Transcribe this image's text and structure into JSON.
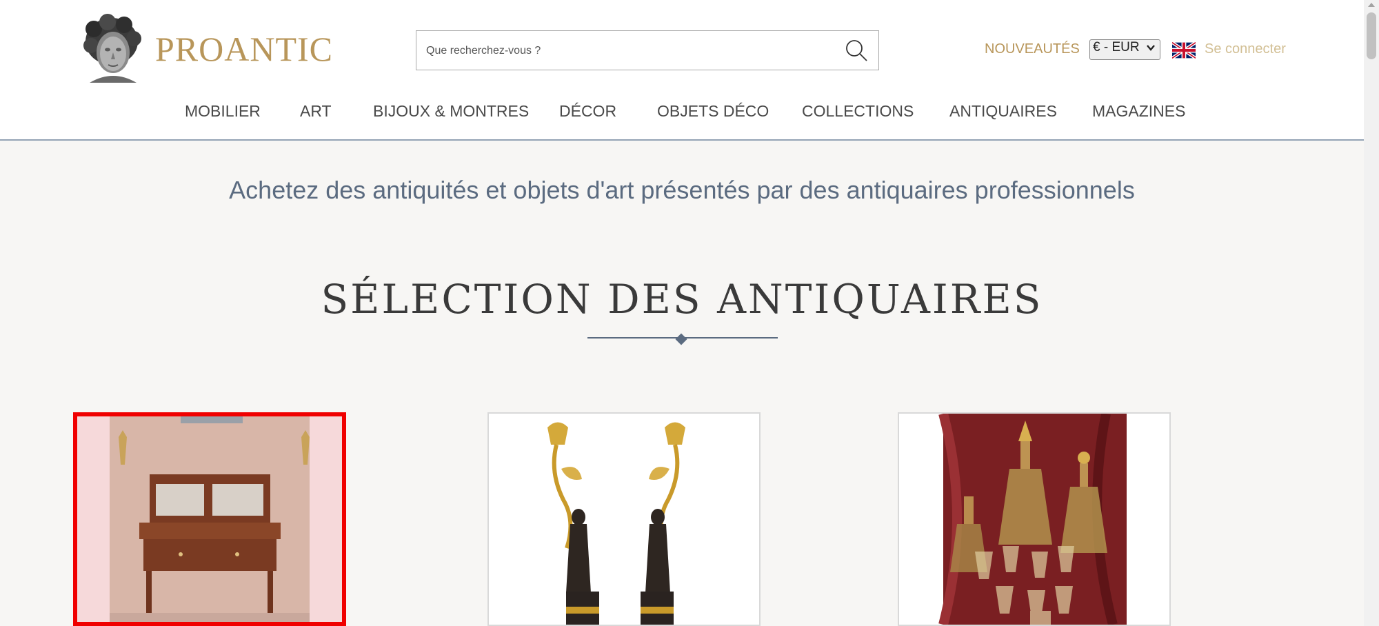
{
  "brand": {
    "name": "PROANTIC"
  },
  "search": {
    "placeholder": "Que recherchez-vous ?"
  },
  "header": {
    "nouveautes": "NOUVEAUTÉS",
    "currency": "€ - EUR",
    "connect": "Se connecter"
  },
  "nav": {
    "items": [
      {
        "label": "MOBILIER"
      },
      {
        "label": "ART"
      },
      {
        "label": "BIJOUX & MONTRES"
      },
      {
        "label": "DÉCOR"
      },
      {
        "label": "OBJETS DÉCO"
      },
      {
        "label": "COLLECTIONS"
      },
      {
        "label": "ANTIQUAIRES"
      },
      {
        "label": "MAGAZINES"
      }
    ]
  },
  "main": {
    "tagline": "Achetez des antiquités et objets d'art présentés par des antiquaires professionnels",
    "section_title": "SÉLECTION DES ANTIQUAIRES"
  },
  "colors": {
    "brand_gold": "#b8965a",
    "accent_blue": "#5b6b80",
    "highlight_red": "#f00000"
  },
  "icons": [
    "bust-logo-icon",
    "search-icon",
    "uk-flag-icon",
    "chevron-down-icon"
  ]
}
